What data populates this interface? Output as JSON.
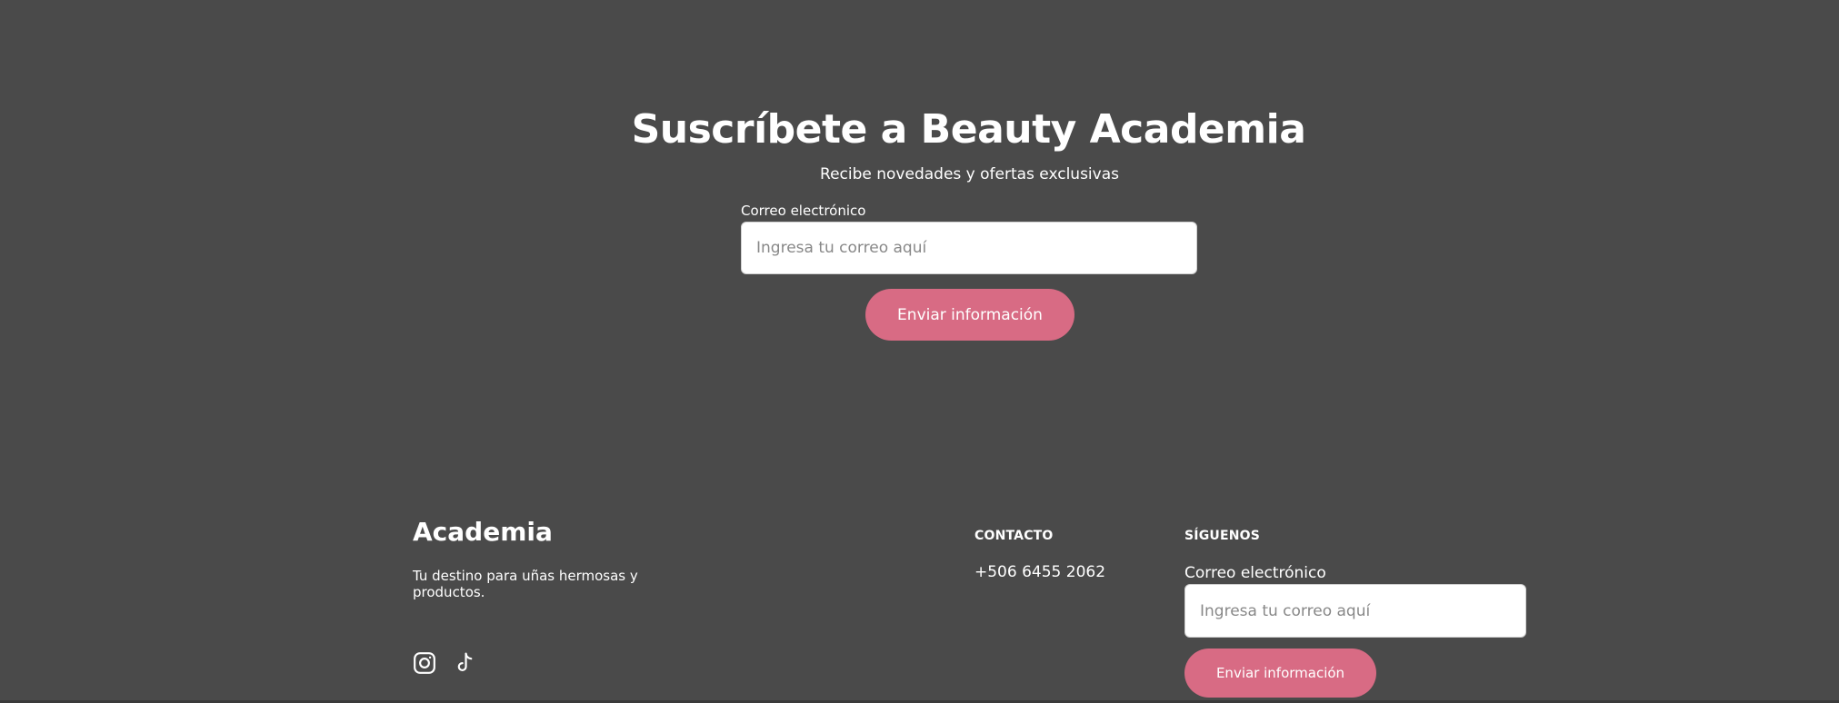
{
  "subscribe": {
    "title": "Suscríbete a Beauty Academia",
    "subtitle": "Recibe novedades y ofertas exclusivas",
    "email_label": "Correo electrónico",
    "email_placeholder": "Ingresa tu correo aquí",
    "email_value": "",
    "button_label": "Enviar información"
  },
  "footer": {
    "brand": "Academia",
    "tagline": "Tu destino para uñas hermosas y productos.",
    "social": [
      {
        "icon": "instagram-icon"
      },
      {
        "icon": "tiktok-icon"
      }
    ],
    "contact": {
      "heading": "CONTACTO",
      "phone": "+506 6455 2062"
    },
    "follow": {
      "heading": "SÍGUENOS",
      "email_label": "Correo electrónico",
      "email_placeholder": "Ingresa tu correo aquí",
      "email_value": "",
      "button_label": "Enviar información"
    }
  },
  "colors": {
    "background": "#4a4a4a",
    "accent": "#d86b84",
    "text": "#ffffff"
  }
}
